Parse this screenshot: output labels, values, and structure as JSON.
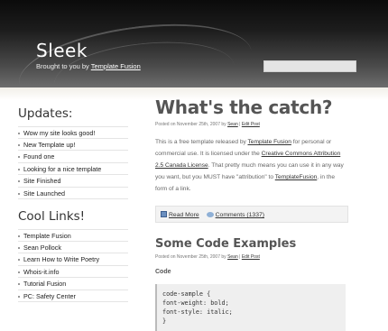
{
  "header": {
    "site_title": "Sleek",
    "tagline_prefix": "Brought to you by ",
    "tagline_link": "Template Fusion",
    "search": {
      "value": "",
      "placeholder": ""
    }
  },
  "sidebar": {
    "updates_heading": "Updates:",
    "updates": [
      "Wow my site looks good!",
      "New Template up!",
      "Found one",
      "Looking for a nice template",
      "Site Finished",
      "Site Launched"
    ],
    "links_heading": "Cool Links!",
    "links": [
      "Template Fusion",
      "Sean Pollock",
      "Learn How to Write Poetry",
      "Whois-it.info",
      "Tutorial Fusion",
      "PC: Safety Center"
    ]
  },
  "post1": {
    "title": "What's the catch?",
    "meta_prefix": "Posted on November 25th, 2007 by ",
    "meta_author": "Sean",
    "meta_sep": " | ",
    "meta_edit": "Edit Post",
    "body_1": "This is a free template released by ",
    "body_link_1": "Template Fusion",
    "body_2": " for personal or commercial use. It is licensed under the ",
    "body_link_2": "Creative Commons Attribution 2.5 Canada License",
    "body_3": ". That pretty much means you can use it in any way you want, but you MUST have \"attribution\" to ",
    "body_link_3": "TemplateFusion",
    "body_4": ", in the form of a link.",
    "read_more": "Read More",
    "comments": "Comments (1337)"
  },
  "post2": {
    "title": "Some Code Examples",
    "meta_prefix": "Posted on November 25th, 2007 by ",
    "meta_author": "Sean",
    "meta_sep": " | ",
    "meta_edit": "Edit Post",
    "sub_heading": "Code",
    "code": "code-sample {\nfont-weight: bold;\nfont-style: italic;\n}"
  }
}
